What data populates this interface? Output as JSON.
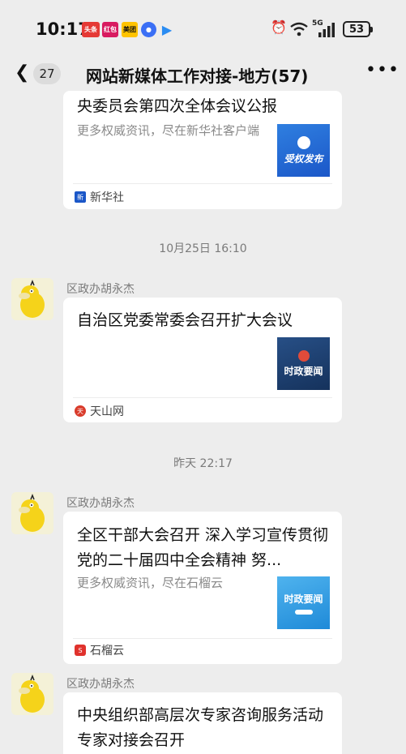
{
  "status": {
    "time": "10:17",
    "battery": "53",
    "network": "5G",
    "app_badges": [
      "头条",
      "红包",
      "美团"
    ]
  },
  "header": {
    "back_count": "27",
    "title": "网站新媒体工作对接-地方(57)"
  },
  "messages": [
    {
      "title": "央委员会第四次全体会议公报",
      "desc": "更多权威资讯，尽在新华社客户端",
      "thumb_text": "受权发布",
      "source": "新华社"
    },
    {
      "timestamp": "10月25日 16:10",
      "sender": "区政办胡永杰",
      "title": "自治区党委常委会召开扩大会议",
      "thumb_text": "时政要闻",
      "source": "天山网"
    },
    {
      "timestamp": "昨天 22:17",
      "sender": "区政办胡永杰",
      "title": "全区干部大会召开 深入学习宣传贯彻党的二十届四中全会精神 努...",
      "desc": "更多权威资讯，尽在石榴云",
      "thumb_text": "时政要闻",
      "source": "石榴云"
    },
    {
      "sender": "区政办胡永杰",
      "title": "中央组织部高层次专家咨询服务活动专家对接会召开"
    }
  ],
  "colors": {
    "background": "#ededed",
    "card": "#ffffff",
    "xinhua_blue": "#1b57c8",
    "tianshan_navy": "#1d3f6e",
    "shiliu_blue": "#1f8ad8",
    "shiliu_red": "#e0322d"
  }
}
